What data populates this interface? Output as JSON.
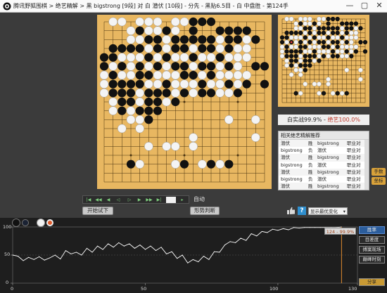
{
  "window": {
    "title": "腾讯野狐围棋 > 绝艺精解 > 黑 bigstrong [9段] 对 白 潜伏 [10段] - 分先 - 黑贴6.5目 - 白 中盘胜 - 第124手",
    "minimize": "—",
    "maximize": "▢",
    "close": "✕"
  },
  "board": {
    "size": 19,
    "last_move_number": "124",
    "black": [
      [
        10,
        0
      ],
      [
        11,
        0
      ],
      [
        12,
        0
      ],
      [
        4,
        1
      ],
      [
        7,
        1
      ],
      [
        10,
        1
      ],
      [
        13,
        1
      ],
      [
        14,
        1
      ],
      [
        15,
        1
      ],
      [
        16,
        1
      ],
      [
        5,
        2
      ],
      [
        6,
        2
      ],
      [
        8,
        2
      ],
      [
        9,
        2
      ],
      [
        10,
        2
      ],
      [
        11,
        2
      ],
      [
        12,
        2
      ],
      [
        14,
        2
      ],
      [
        15,
        2
      ],
      [
        17,
        2
      ],
      [
        1,
        3
      ],
      [
        2,
        3
      ],
      [
        3,
        3
      ],
      [
        4,
        3
      ],
      [
        6,
        3
      ],
      [
        8,
        3
      ],
      [
        9,
        3
      ],
      [
        11,
        3
      ],
      [
        12,
        3
      ],
      [
        14,
        3
      ],
      [
        0,
        4
      ],
      [
        1,
        4
      ],
      [
        5,
        4
      ],
      [
        7,
        4
      ],
      [
        10,
        4
      ],
      [
        13,
        4
      ],
      [
        0,
        5
      ],
      [
        2,
        5
      ],
      [
        4,
        5
      ],
      [
        6,
        5
      ],
      [
        8,
        5
      ],
      [
        9,
        5
      ],
      [
        11,
        5
      ],
      [
        12,
        5
      ],
      [
        14,
        5
      ],
      [
        17,
        5
      ],
      [
        18,
        5
      ],
      [
        1,
        6
      ],
      [
        4,
        6
      ],
      [
        5,
        6
      ],
      [
        9,
        6
      ],
      [
        10,
        6
      ],
      [
        12,
        6
      ],
      [
        1,
        7
      ],
      [
        2,
        7
      ],
      [
        3,
        7
      ],
      [
        4,
        7
      ],
      [
        7,
        7
      ],
      [
        11,
        7
      ],
      [
        14,
        7
      ],
      [
        16,
        7
      ],
      [
        18,
        7
      ],
      [
        1,
        8
      ],
      [
        2,
        8
      ],
      [
        3,
        8
      ],
      [
        5,
        8
      ],
      [
        6,
        8
      ],
      [
        7,
        8
      ],
      [
        9,
        8
      ],
      [
        11,
        8
      ],
      [
        12,
        8
      ],
      [
        15,
        8
      ],
      [
        2,
        9
      ],
      [
        3,
        9
      ],
      [
        5,
        9
      ],
      [
        6,
        9
      ],
      [
        8,
        9
      ],
      [
        2,
        10
      ],
      [
        4,
        10
      ],
      [
        5,
        10
      ],
      [
        6,
        10
      ],
      [
        5,
        11
      ],
      [
        3,
        16
      ],
      [
        9,
        16
      ],
      [
        12,
        16
      ],
      [
        14,
        16
      ]
    ],
    "white": [
      [
        1,
        0
      ],
      [
        2,
        0
      ],
      [
        4,
        0
      ],
      [
        5,
        0
      ],
      [
        6,
        0
      ],
      [
        8,
        0
      ],
      [
        9,
        0
      ],
      [
        3,
        1
      ],
      [
        5,
        1
      ],
      [
        6,
        1
      ],
      [
        8,
        1
      ],
      [
        3,
        2
      ],
      [
        4,
        2
      ],
      [
        7,
        2
      ],
      [
        13,
        2
      ],
      [
        16,
        2
      ],
      [
        5,
        3
      ],
      [
        7,
        3
      ],
      [
        10,
        3
      ],
      [
        13,
        3
      ],
      [
        15,
        3
      ],
      [
        16,
        3
      ],
      [
        2,
        4
      ],
      [
        3,
        4
      ],
      [
        4,
        4
      ],
      [
        6,
        4
      ],
      [
        8,
        4
      ],
      [
        9,
        4
      ],
      [
        11,
        4
      ],
      [
        12,
        4
      ],
      [
        14,
        4
      ],
      [
        15,
        4
      ],
      [
        16,
        4
      ],
      [
        1,
        5
      ],
      [
        3,
        5
      ],
      [
        5,
        5
      ],
      [
        7,
        5
      ],
      [
        10,
        5
      ],
      [
        13,
        5
      ],
      [
        15,
        5
      ],
      [
        0,
        6
      ],
      [
        2,
        6
      ],
      [
        3,
        6
      ],
      [
        6,
        6
      ],
      [
        7,
        6
      ],
      [
        8,
        6
      ],
      [
        11,
        6
      ],
      [
        13,
        6
      ],
      [
        14,
        6
      ],
      [
        15,
        6
      ],
      [
        16,
        6
      ],
      [
        0,
        7
      ],
      [
        5,
        7
      ],
      [
        6,
        7
      ],
      [
        8,
        7
      ],
      [
        9,
        7
      ],
      [
        10,
        7
      ],
      [
        12,
        7
      ],
      [
        13,
        7
      ],
      [
        15,
        7
      ],
      [
        0,
        8
      ],
      [
        4,
        8
      ],
      [
        8,
        8
      ],
      [
        10,
        8
      ],
      [
        13,
        8
      ],
      [
        14,
        8
      ],
      [
        1,
        9
      ],
      [
        4,
        9
      ],
      [
        7,
        9
      ],
      [
        1,
        10
      ],
      [
        3,
        10
      ],
      [
        3,
        11
      ],
      [
        4,
        11
      ],
      [
        14,
        11
      ],
      [
        17,
        11
      ],
      [
        2,
        12
      ],
      [
        4,
        12
      ],
      [
        10,
        13
      ],
      [
        17,
        13
      ],
      [
        5,
        14
      ],
      [
        7,
        14
      ],
      [
        8,
        14
      ],
      [
        10,
        14
      ],
      [
        4,
        16
      ],
      [
        8,
        16
      ],
      [
        11,
        16
      ],
      [
        13,
        16
      ]
    ],
    "marked_stone": [
      2,
      5
    ]
  },
  "win_rate": {
    "text": "白实战99.9% - ",
    "ai_text": "绝艺100.0%"
  },
  "recommendations": {
    "title": "相关绝艺精解推荐",
    "rows": [
      {
        "player": "潜伏",
        "result": "胜",
        "opponent": "bigstrong",
        "type": "职业对"
      },
      {
        "player": "bigstrong",
        "result": "负",
        "opponent": "潜伏",
        "type": "职业对"
      },
      {
        "player": "潜伏",
        "result": "胜",
        "opponent": "bigstrong",
        "type": "职业对"
      },
      {
        "player": "bigstrong",
        "result": "负",
        "opponent": "潜伏",
        "type": "职业对"
      },
      {
        "player": "潜伏",
        "result": "胜",
        "opponent": "bigstrong",
        "type": "职业对"
      },
      {
        "player": "bigstrong",
        "result": "负",
        "opponent": "潜伏",
        "type": "职业对"
      },
      {
        "player": "潜伏",
        "result": "胜",
        "opponent": "bigstrong",
        "type": "职业对"
      }
    ]
  },
  "side_buttons": {
    "hand_count": "手数",
    "coordinates": "坐标"
  },
  "controls": {
    "first": "|◀",
    "prev10": "◀◀",
    "prev5": "◀",
    "prev": "◁",
    "next": "▷",
    "next5": "▶",
    "next10": "▶▶",
    "last": "▶|",
    "auto_play": "自动",
    "try_play": "开始试下",
    "judge": "形势判断",
    "variation_label": "显示最优变化",
    "help": "?"
  },
  "graph": {
    "tooltip": "124 - 99.9%",
    "y_labels": [
      "100",
      "50",
      "0"
    ],
    "x_labels": [
      "0",
      "50",
      "100",
      "130"
    ],
    "buttons": [
      "胜率",
      "目差度",
      "搏案现场",
      "巅峰时刻",
      "分享"
    ],
    "colors": {
      "line": "#ffffff",
      "marker": "#e08a2e",
      "active_button": "#2b5d9c"
    }
  },
  "chart_data": {
    "type": "line",
    "title": "",
    "xlabel": "",
    "ylabel": "",
    "xlim": [
      0,
      130
    ],
    "ylim": [
      0,
      100
    ],
    "x_ticks": [
      0,
      50,
      100,
      130
    ],
    "y_ticks": [
      0,
      50,
      100
    ],
    "marker_x": 124,
    "series": [
      {
        "x": [
          0,
          2,
          4,
          6,
          8,
          10,
          12,
          14,
          16,
          18,
          20,
          22,
          24,
          26,
          28,
          30,
          32,
          34,
          36,
          38,
          40,
          42,
          44,
          46,
          48,
          50,
          52,
          54,
          56,
          58,
          60,
          62,
          64,
          66,
          68,
          70,
          72,
          74,
          76,
          78,
          80,
          82,
          84,
          86,
          88,
          90,
          92,
          94,
          96,
          98,
          100,
          102,
          104,
          106,
          108,
          110,
          112,
          114,
          116,
          118,
          120,
          122,
          124
        ],
        "values": [
          50,
          48,
          40,
          46,
          42,
          47,
          41,
          45,
          50,
          43,
          58,
          52,
          55,
          50,
          62,
          55,
          66,
          60,
          70,
          64,
          72,
          66,
          70,
          62,
          68,
          60,
          66,
          58,
          64,
          52,
          56,
          44,
          50,
          36,
          42,
          38,
          48,
          42,
          56,
          55,
          68,
          74,
          72,
          80,
          76,
          88,
          84,
          92,
          90,
          96,
          94,
          97,
          95,
          99,
          98,
          99,
          99,
          99,
          99,
          99,
          99,
          99,
          99.9
        ]
      }
    ]
  }
}
